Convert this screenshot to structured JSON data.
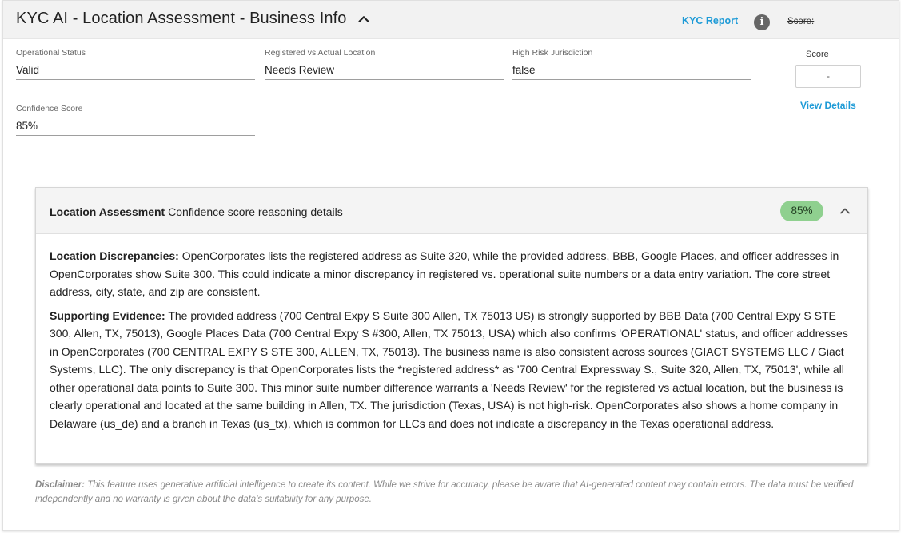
{
  "header": {
    "title": "KYC AI - Location Assessment - Business Info",
    "kyc_report_link": "KYC Report",
    "score_label": "Score:"
  },
  "fields": {
    "operational_status": {
      "label": "Operational Status",
      "value": "Valid"
    },
    "registered_vs_actual": {
      "label": "Registered vs Actual Location",
      "value": "Needs Review"
    },
    "high_risk_jurisdiction": {
      "label": "High Risk Jurisdiction",
      "value": "false"
    },
    "confidence_score": {
      "label": "Confidence Score",
      "value": "85%"
    }
  },
  "score_box": {
    "label": "Score",
    "value": "-",
    "view_details": "View Details"
  },
  "assessment": {
    "title_bold": "Location Assessment",
    "title_rest": " Confidence score reasoning details",
    "badge": "85%",
    "discrepancies_label": "Location Discrepancies:",
    "discrepancies_text": " OpenCorporates lists the registered address as Suite 320, while the provided address, BBB, Google Places, and officer addresses in OpenCorporates show Suite 300. This could indicate a minor discrepancy in registered vs. operational suite numbers or a data entry variation. The core street address, city, state, and zip are consistent.",
    "evidence_label": "Supporting Evidence:",
    "evidence_text": " The provided address (700 Central Expy S Suite 300 Allen, TX 75013 US) is strongly supported by BBB Data (700 Central Expy S STE 300, Allen, TX, 75013), Google Places Data (700 Central Expy S #300, Allen, TX 75013, USA) which also confirms 'OPERATIONAL' status, and officer addresses in OpenCorporates (700 CENTRAL EXPY S STE 300, ALLEN, TX, 75013). The business name is also consistent across sources (GIACT SYSTEMS LLC / Giact Systems, LLC). The only discrepancy is that OpenCorporates lists the *registered address* as '700 Central Expressway S., Suite 320, Allen, TX, 75013', while all other operational data points to Suite 300. This minor suite number difference warrants a 'Needs Review' for the registered vs actual location, but the business is clearly operational and located at the same building in Allen, TX. The jurisdiction (Texas, USA) is not high-risk. OpenCorporates also shows a home company in Delaware (us_de) and a branch in Texas (us_tx), which is common for LLCs and does not indicate a discrepancy in the Texas operational address."
  },
  "disclaimer": {
    "label": "Disclaimer:",
    "text": " This feature uses generative artificial intelligence to create its content. While we strive for accuracy, please be aware that AI-generated content may contain errors. The data must be verified independently and no warranty is given about the data's suitability for any purpose."
  },
  "icons": {
    "collapse": "chevron-up-icon",
    "info": "info-icon",
    "panel_collapse": "chevron-up-icon",
    "info_glyph": "i"
  },
  "colors": {
    "link": "#1e9bd7",
    "badge_bg": "#8fd08f",
    "header_bg": "#f2f2f2"
  }
}
